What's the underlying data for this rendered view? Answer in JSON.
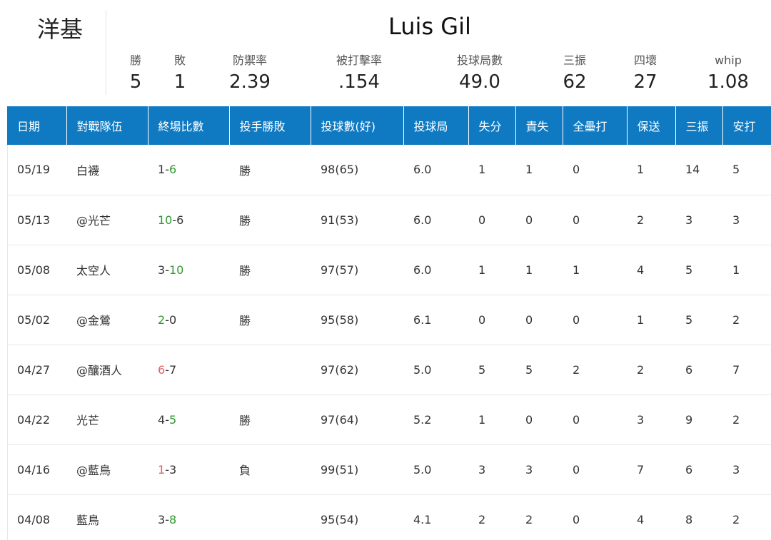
{
  "team": "洋基",
  "player_name": "Luis Gil",
  "summary": [
    {
      "label": "勝",
      "value": "5"
    },
    {
      "label": "敗",
      "value": "1"
    },
    {
      "label": "防禦率",
      "value": "2.39"
    },
    {
      "label": "被打擊率",
      "value": ".154"
    },
    {
      "label": "投球局數",
      "value": "49.0"
    },
    {
      "label": "三振",
      "value": "62"
    },
    {
      "label": "四壞",
      "value": "27"
    },
    {
      "label": "whip",
      "value": "1.08"
    }
  ],
  "columns": [
    "日期",
    "對戰隊伍",
    "終場比數",
    "投手勝敗",
    "投球數(好)",
    "投球局",
    "失分",
    "責失",
    "全壘打",
    "保送",
    "三振",
    "安打"
  ],
  "colors": {
    "header_bg": "#0f7ac2",
    "win": "#2e9a31",
    "loss": "#e06060"
  },
  "games": [
    {
      "date": "05/19",
      "opponent": "白襪",
      "score_a": "1",
      "score_b": "6",
      "winner_side": "b",
      "decision": "勝",
      "decision_type": "win",
      "pitches": "98(65)",
      "ip": "6.0",
      "r": "1",
      "er": "1",
      "hr": "0",
      "bb": "1",
      "so": "14",
      "h": "5"
    },
    {
      "date": "05/13",
      "opponent": "@光芒",
      "score_a": "10",
      "score_b": "6",
      "winner_side": "a",
      "decision": "勝",
      "decision_type": "win",
      "pitches": "91(53)",
      "ip": "6.0",
      "r": "0",
      "er": "0",
      "hr": "0",
      "bb": "2",
      "so": "3",
      "h": "3"
    },
    {
      "date": "05/08",
      "opponent": "太空人",
      "score_a": "3",
      "score_b": "10",
      "winner_side": "b",
      "decision": "勝",
      "decision_type": "win",
      "pitches": "97(57)",
      "ip": "6.0",
      "r": "1",
      "er": "1",
      "hr": "1",
      "bb": "4",
      "so": "5",
      "h": "1"
    },
    {
      "date": "05/02",
      "opponent": "@金鶯",
      "score_a": "2",
      "score_b": "0",
      "winner_side": "a",
      "decision": "勝",
      "decision_type": "win",
      "pitches": "95(58)",
      "ip": "6.1",
      "r": "0",
      "er": "0",
      "hr": "0",
      "bb": "1",
      "so": "5",
      "h": "2"
    },
    {
      "date": "04/27",
      "opponent": "@釀酒人",
      "score_a": "6",
      "score_b": "7",
      "winner_side": "a_loss",
      "decision": "",
      "decision_type": "none",
      "pitches": "97(62)",
      "ip": "5.0",
      "r": "5",
      "er": "5",
      "hr": "2",
      "bb": "2",
      "so": "6",
      "h": "7"
    },
    {
      "date": "04/22",
      "opponent": "光芒",
      "score_a": "4",
      "score_b": "5",
      "winner_side": "b",
      "decision": "勝",
      "decision_type": "win",
      "pitches": "97(64)",
      "ip": "5.2",
      "r": "1",
      "er": "0",
      "hr": "0",
      "bb": "3",
      "so": "9",
      "h": "2"
    },
    {
      "date": "04/16",
      "opponent": "@藍鳥",
      "score_a": "1",
      "score_b": "3",
      "winner_side": "a_loss",
      "decision": "負",
      "decision_type": "loss",
      "pitches": "99(51)",
      "ip": "5.0",
      "r": "3",
      "er": "3",
      "hr": "0",
      "bb": "7",
      "so": "6",
      "h": "3"
    },
    {
      "date": "04/08",
      "opponent": "藍鳥",
      "score_a": "3",
      "score_b": "8",
      "winner_side": "b",
      "decision": "",
      "decision_type": "none",
      "pitches": "95(54)",
      "ip": "4.1",
      "r": "2",
      "er": "2",
      "hr": "0",
      "bb": "4",
      "so": "8",
      "h": "2"
    }
  ]
}
